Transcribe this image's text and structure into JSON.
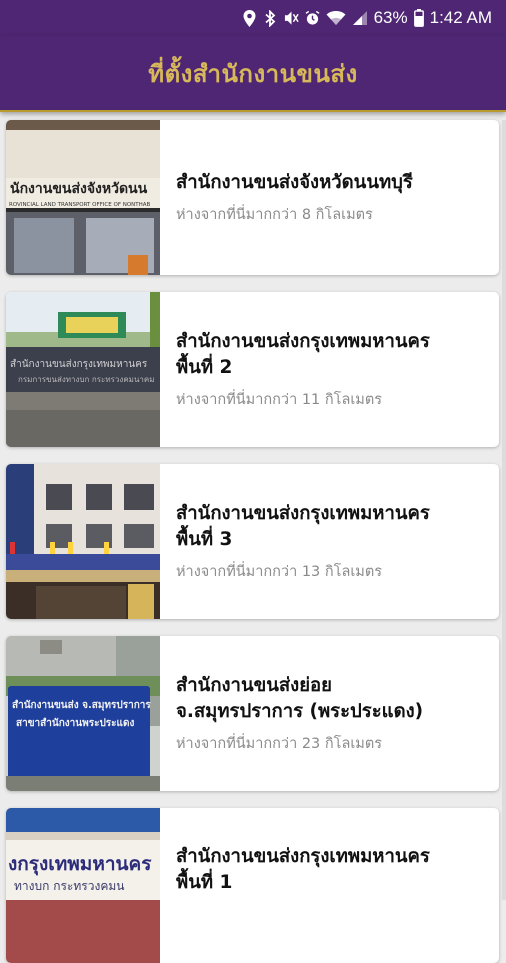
{
  "status_bar": {
    "battery": "63%",
    "time": "1:42 AM"
  },
  "app_bar": {
    "title": "ที่ตั้งสำนักงานขนส่ง"
  },
  "offices": [
    {
      "name_line1": "สำนักงานขนส่งจังหวัดนนทบุรี",
      "name_line2": "",
      "distance": "ห่างจากที่นี่มากกว่า 8 กิโลเมตร",
      "photo_sign_text": "นักงานขนส่งจังหวัดนน",
      "photo_sign_text2": "ROVINCIAL LAND TRANSPORT OFFICE OF NONTHAB"
    },
    {
      "name_line1": "สำนักงานขนส่งกรุงเทพมหานคร",
      "name_line2": "พื้นที่ 2",
      "distance": "ห่างจากที่นี่มากกว่า 11 กิโลเมตร",
      "photo_sign_text": "สำนักงานขนส่งกรุงเทพมหานคร",
      "photo_sign_text2": "กรมการขนส่งทางบก กระทรวงคมนาคม"
    },
    {
      "name_line1": "สำนักงานขนส่งกรุงเทพมหานคร",
      "name_line2": "พื้นที่ 3",
      "distance": "ห่างจากที่นี่มากกว่า 13 กิโลเมตร",
      "photo_sign_text": "",
      "photo_sign_text2": ""
    },
    {
      "name_line1": "สำนักงานขนส่งย่อย",
      "name_line2": "จ.สมุทรปราการ (พระประแดง)",
      "distance": "ห่างจากที่นี่มากกว่า 23 กิโลเมตร",
      "photo_sign_text": "สำนักงานขนส่ง จ.สมุทรปราการ",
      "photo_sign_text2": "สาขาสำนักงานพระประแดง"
    },
    {
      "name_line1": "สำนักงานขนส่งกรุงเทพมหานคร",
      "name_line2": "พื้นที่ 1",
      "distance": "",
      "photo_sign_text": "งกรุงเทพมหานคร",
      "photo_sign_text2": "ทางบก กระทรวงคมน"
    }
  ]
}
